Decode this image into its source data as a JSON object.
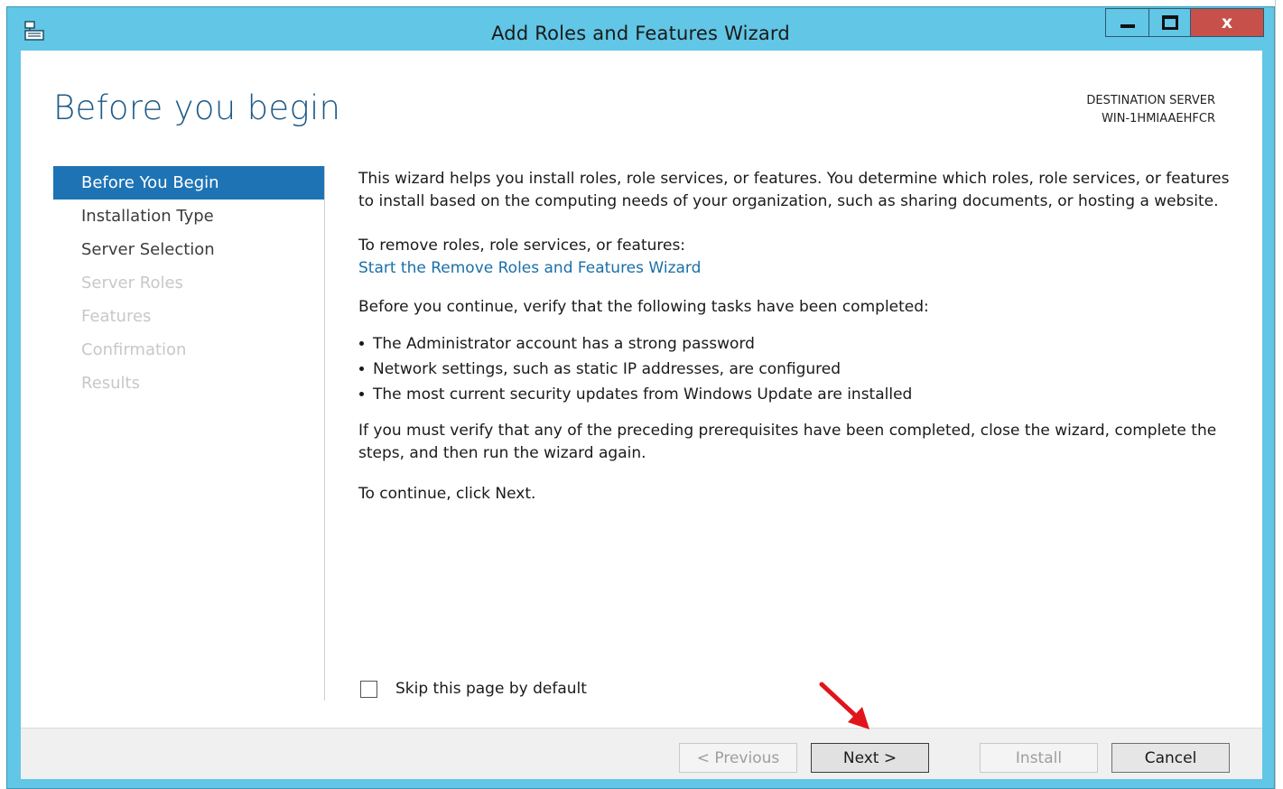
{
  "window": {
    "title": "Add Roles and Features Wizard",
    "controls": {
      "close_label": "x"
    }
  },
  "header": {
    "page_title": "Before you begin",
    "destination_label": "DESTINATION SERVER",
    "destination_server": "WIN-1HMIAAEHFCR"
  },
  "nav": {
    "items": [
      {
        "label": "Before You Begin",
        "state": "active"
      },
      {
        "label": "Installation Type",
        "state": "enabled"
      },
      {
        "label": "Server Selection",
        "state": "enabled"
      },
      {
        "label": "Server Roles",
        "state": "disabled"
      },
      {
        "label": "Features",
        "state": "disabled"
      },
      {
        "label": "Confirmation",
        "state": "disabled"
      },
      {
        "label": "Results",
        "state": "disabled"
      }
    ]
  },
  "main": {
    "intro": "This wizard helps you install roles, role services, or features. You determine which roles, role services, or features to install based on the computing needs of your organization, such as sharing documents, or hosting a website.",
    "remove_prompt": "To remove roles, role services, or features:",
    "remove_link": "Start the Remove Roles and Features Wizard",
    "verify_prompt": "Before you continue, verify that the following tasks have been completed:",
    "tasks": [
      "The Administrator account has a strong password",
      "Network settings, such as static IP addresses, are configured",
      "The most current security updates from Windows Update are installed"
    ],
    "verify_note": "If you must verify that any of the preceding prerequisites have been completed, close the wizard, complete the steps, and then run the wizard again.",
    "continue_note": "To continue, click Next."
  },
  "skip": {
    "label": "Skip this page by default",
    "checked": false
  },
  "footer": {
    "previous_label": "< Previous",
    "next_label": "Next >",
    "install_label": "Install",
    "cancel_label": "Cancel"
  },
  "colors": {
    "titlebar": "#62c6e6",
    "accent": "#1e73b5",
    "title_text": "#1e5a88",
    "link": "#1a6fa8",
    "close_button": "#c7504a",
    "annotation_arrow": "#e0151b"
  }
}
